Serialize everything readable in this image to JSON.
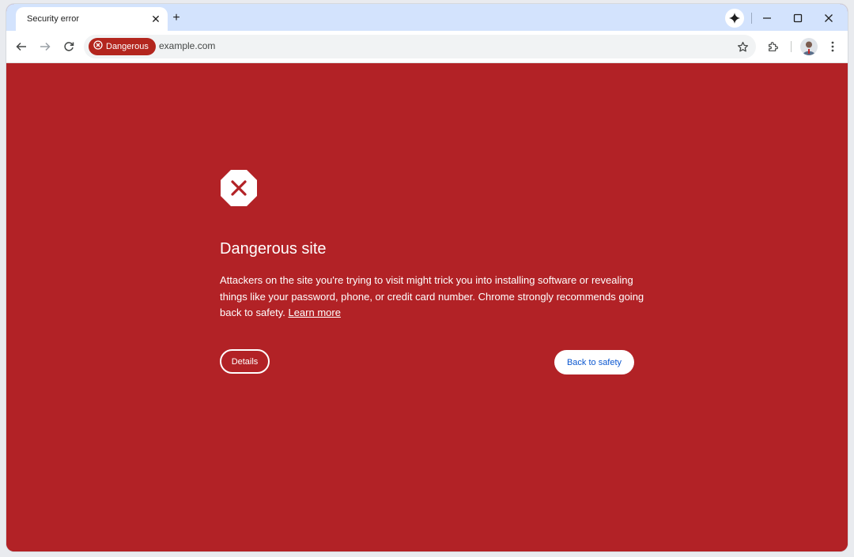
{
  "tab": {
    "title": "Security error",
    "close_icon": "close-icon"
  },
  "toolbar": {
    "security_chip_label": "Dangerous",
    "url": "example.com"
  },
  "interstitial": {
    "heading": "Dangerous site",
    "body": "Attackers on the site you're trying to visit might trick you into installing software or revealing things like your password, phone, or credit card number. Chrome strongly recommends going back to safety. ",
    "learn_more": "Learn more",
    "details_button": "Details",
    "back_button": "Back to safety"
  },
  "colors": {
    "danger_background": "#b22226",
    "tabstrip": "#d3e3fd",
    "primary_button_text": "#0b57d0"
  },
  "icons": [
    "back-arrow-icon",
    "forward-arrow-icon",
    "reload-icon",
    "danger-icon",
    "bookmark-star-icon",
    "extensions-icon",
    "more-icon",
    "gemini-icon",
    "minimize-icon",
    "maximize-icon",
    "close-window-icon",
    "stop-sign-icon"
  ]
}
